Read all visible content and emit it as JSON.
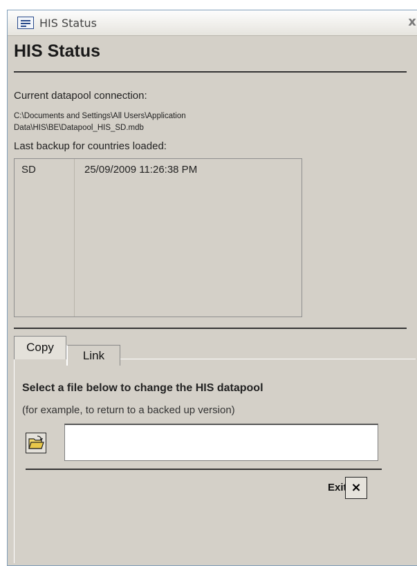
{
  "window": {
    "title": "HIS Status",
    "close_glyph": "x"
  },
  "heading": "HIS Status",
  "connection": {
    "label": "Current datapool connection:",
    "path_line1": "C:\\Documents and Settings\\All Users\\Application",
    "path_line2": "Data\\HIS\\BE\\Datapool_HIS_SD.mdb"
  },
  "backup": {
    "label": "Last backup for countries loaded:",
    "rows": [
      {
        "country": "SD",
        "timestamp": "25/09/2009 11:26:38 PM"
      }
    ]
  },
  "tabs": [
    {
      "label": "Copy",
      "active": true
    },
    {
      "label": "Link",
      "active": false
    }
  ],
  "copy_panel": {
    "title": "Select a file below to change the HIS datapool",
    "subtitle": "(for example, to return to a backed up version)",
    "file_value": "",
    "browse_icon": "open-folder-icon"
  },
  "exit": {
    "label": "Exit",
    "glyph": "×"
  },
  "colors": {
    "window_bg": "#d4d0c8",
    "title_bar": "#f0efeb",
    "folder_icon": "#e8c84a"
  }
}
